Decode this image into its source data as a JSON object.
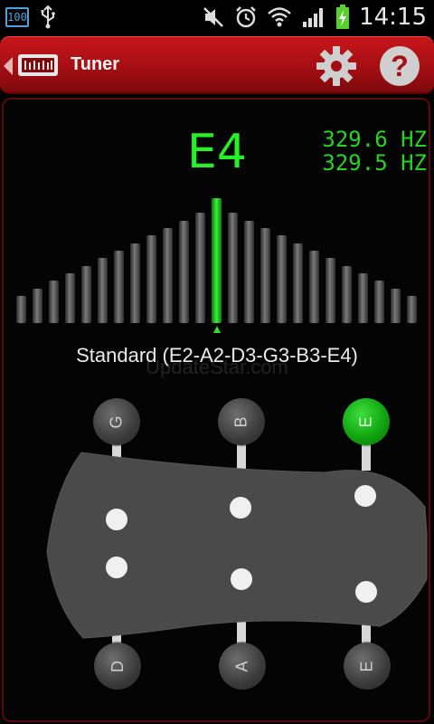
{
  "status_bar": {
    "battery_percent": "100",
    "time": "14:15"
  },
  "app": {
    "title": "Tuner"
  },
  "tuner": {
    "note": "E4",
    "frequency_detected": "329.6 HZ",
    "frequency_target": "329.5 HZ",
    "tuning_name": "Standard (E2-A2-D3-G3-B3-E4)",
    "watermark": "UpdateStar.com",
    "active_bar_index": 12,
    "bar_count": 25
  },
  "strings": {
    "top": [
      {
        "label": "G",
        "active": false
      },
      {
        "label": "B",
        "active": false
      },
      {
        "label": "E",
        "active": true
      }
    ],
    "bottom": [
      {
        "label": "D",
        "active": false
      },
      {
        "label": "A",
        "active": false
      },
      {
        "label": "E",
        "active": false
      }
    ]
  },
  "colors": {
    "accent_red": "#c8161b",
    "note_green": "#26f026",
    "freq_green": "#25d425"
  }
}
